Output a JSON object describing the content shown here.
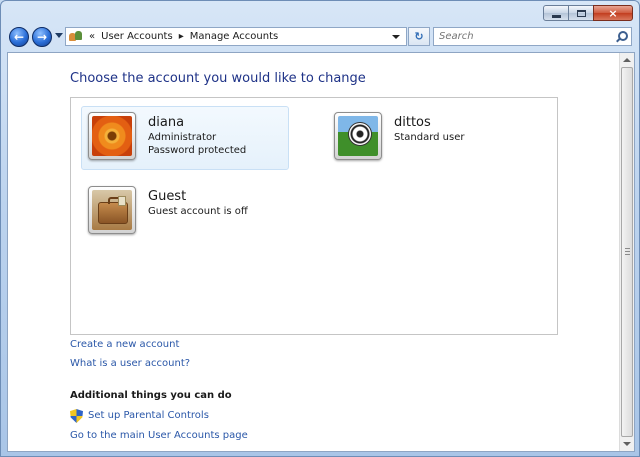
{
  "window": {
    "controls": {
      "minimize": "minimize",
      "maximize": "maximize",
      "close": "×"
    }
  },
  "toolbar": {
    "back_glyph": "←",
    "forward_glyph": "→",
    "breadcrumb": {
      "prefix": "«",
      "items": [
        "User Accounts",
        "Manage Accounts"
      ],
      "separator": "▸"
    },
    "refresh_glyph": "↻",
    "search": {
      "placeholder": "Search",
      "value": ""
    }
  },
  "main": {
    "title": "Choose the account you would like to change",
    "accounts": [
      {
        "name": "diana",
        "lines": [
          "Administrator",
          "Password protected"
        ],
        "avatar": "flower-icon",
        "selected": true
      },
      {
        "name": "dittos",
        "lines": [
          "Standard user"
        ],
        "avatar": "soccer-ball-icon",
        "selected": false
      },
      {
        "name": "Guest",
        "lines": [
          "Guest account is off"
        ],
        "avatar": "suitcase-icon",
        "selected": false
      }
    ],
    "links": {
      "create": "Create a new account",
      "what": "What is a user account?"
    },
    "additional": {
      "heading": "Additional things you can do",
      "parental": "Set up Parental Controls",
      "main_page": "Go to the main User Accounts page"
    }
  },
  "colors": {
    "link": "#2a57a8",
    "title": "#1e3287",
    "selected_bg": "#e5f1fb"
  }
}
